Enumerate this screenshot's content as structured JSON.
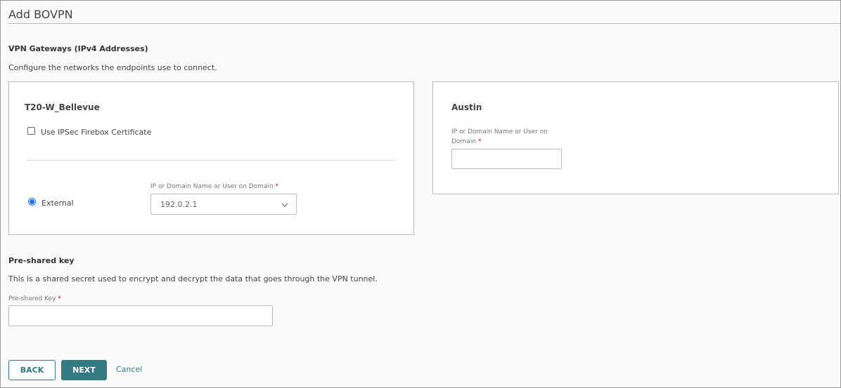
{
  "page": {
    "title": "Add BOVPN"
  },
  "gateways": {
    "heading": "VPN Gateways (IPv4 Addresses)",
    "description": "Configure the networks the endpoints use to connect."
  },
  "local": {
    "name": "T20-W_Bellevue",
    "certificate_label": "Use IPSec Firebox Certificate",
    "certificate_checked": false,
    "interface_label": "External",
    "field_label": "IP or Domain Name or User on Domain",
    "field_value": "192.0.2.1"
  },
  "remote": {
    "name": "Austin",
    "field_label_1": "IP or Domain Name or User on",
    "field_label_2": "Domain",
    "field_value": ""
  },
  "psk": {
    "heading": "Pre-shared key",
    "description": "This is a shared secret used to encrypt and decrypt the data that goes through the VPN tunnel.",
    "field_label": "Pre-shared Key",
    "field_value": ""
  },
  "required_mark": "*",
  "buttons": {
    "back": "BACK",
    "next": "NEXT",
    "cancel": "Cancel"
  },
  "colors": {
    "accent": "#347a84",
    "radio": "#1a73e8"
  }
}
